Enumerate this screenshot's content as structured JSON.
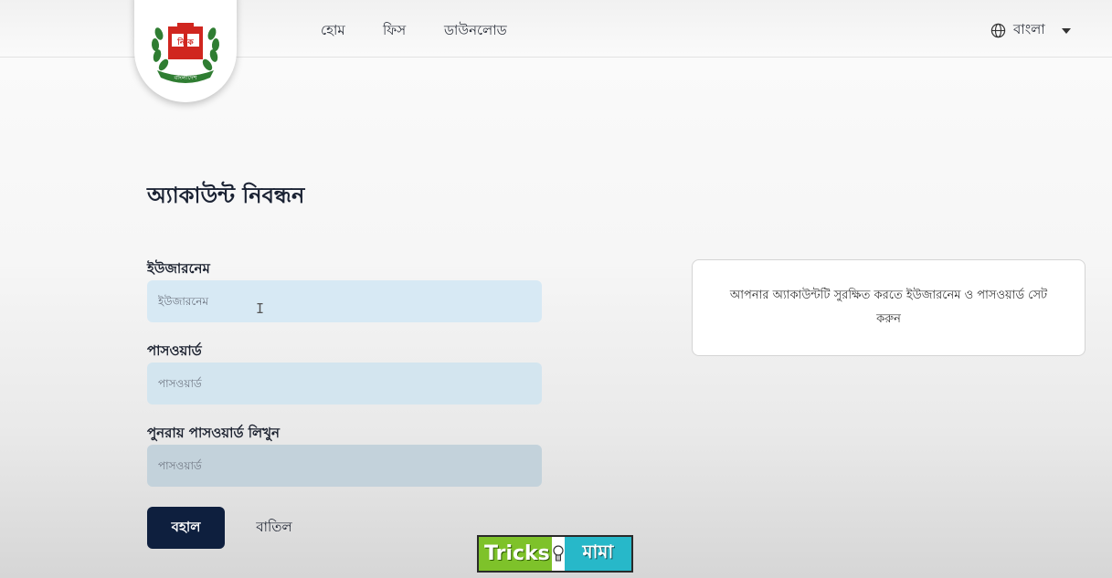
{
  "header": {
    "logo_text": "বাংলাদেশ",
    "logo_ballot_letters": "নি ক",
    "nav": [
      {
        "label": "হোম"
      },
      {
        "label": "ফিস"
      },
      {
        "label": "ডাউনলোড"
      }
    ],
    "language": {
      "label": "বাংলা"
    }
  },
  "form": {
    "title": "অ্যাকাউন্ট নিবন্ধন",
    "username": {
      "label": "ইউজারনেম",
      "placeholder": "ইউজারনেম",
      "value": ""
    },
    "password": {
      "label": "পাসওয়ার্ড",
      "placeholder": "পাসওয়ার্ড",
      "value": ""
    },
    "confirm_password": {
      "label": "পুনরায় পাসওয়ার্ড লিখুন",
      "placeholder": "পাসওয়ার্ড",
      "value": ""
    },
    "submit_label": "বহাল",
    "cancel_label": "বাতিল"
  },
  "info": {
    "text": "আপনার অ্যাকাউন্টটি সুরক্ষিত করতে ইউজারনেম ও পাসওয়ার্ড সেট করুন"
  },
  "watermark": {
    "en": "Tricks",
    "bn": "মামা"
  },
  "colors": {
    "primary_button": "#0e1f3e",
    "input_bg": "#d7e9f4",
    "logo_red": "#d0261f",
    "logo_green": "#2f7d32"
  }
}
